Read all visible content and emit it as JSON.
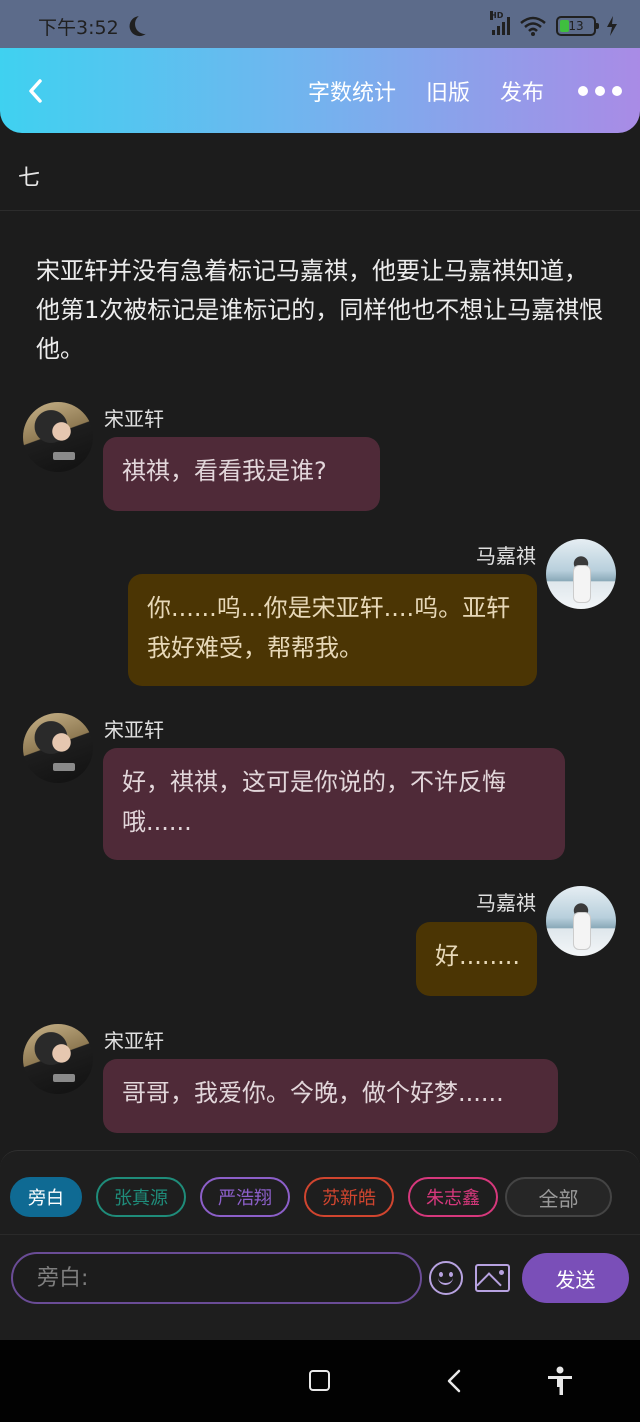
{
  "status_bar": {
    "time": "下午3:52",
    "network_label": "HD",
    "battery_level": "13",
    "icons": [
      "moon-icon",
      "signal-icon",
      "wifi-icon",
      "battery-icon",
      "charging-icon"
    ]
  },
  "header": {
    "back_icon": "chevron-left-icon",
    "word_count_label": "字数统计",
    "old_version_label": "旧版",
    "publish_label": "发布",
    "more_icon": "more-horizontal-icon"
  },
  "chapter": {
    "title": "七"
  },
  "narration": "宋亚轩并没有急着标记马嘉祺，他要让马嘉祺知道，他第1次被标记是谁标记的，同样他也不想让马嘉祺恨他。",
  "messages": [
    {
      "speaker": "宋亚轩",
      "side": "left",
      "text": "祺祺，看看我是谁?"
    },
    {
      "speaker": "马嘉祺",
      "side": "right",
      "text": "你......呜...你是宋亚轩....呜。亚轩我好难受，帮帮我。"
    },
    {
      "speaker": "宋亚轩",
      "side": "left",
      "text": "好，祺祺，这可是你说的，不许反悔哦......"
    },
    {
      "speaker": "马嘉祺",
      "side": "right",
      "text": "好........"
    },
    {
      "speaker": "宋亚轩",
      "side": "left",
      "text": "哥哥，我爱你。今晚，做个好梦......"
    }
  ],
  "roles": [
    {
      "label": "旁白",
      "selected": true,
      "color": "#0f6a93"
    },
    {
      "label": "张真源",
      "selected": false,
      "color": "#1f8c7a"
    },
    {
      "label": "严浩翔",
      "selected": false,
      "color": "#8c5fc9"
    },
    {
      "label": "苏新皓",
      "selected": false,
      "color": "#d0452f"
    },
    {
      "label": "朱志鑫",
      "selected": false,
      "color": "#d6387c"
    }
  ],
  "all_roles_label": "全部",
  "composer": {
    "placeholder": "旁白:",
    "emoji_icon": "emoji-icon",
    "image_icon": "image-icon",
    "send_label": "发送"
  },
  "system_nav": {
    "icons": [
      "home-square-icon",
      "back-triangle-icon",
      "accessibility-icon"
    ]
  }
}
